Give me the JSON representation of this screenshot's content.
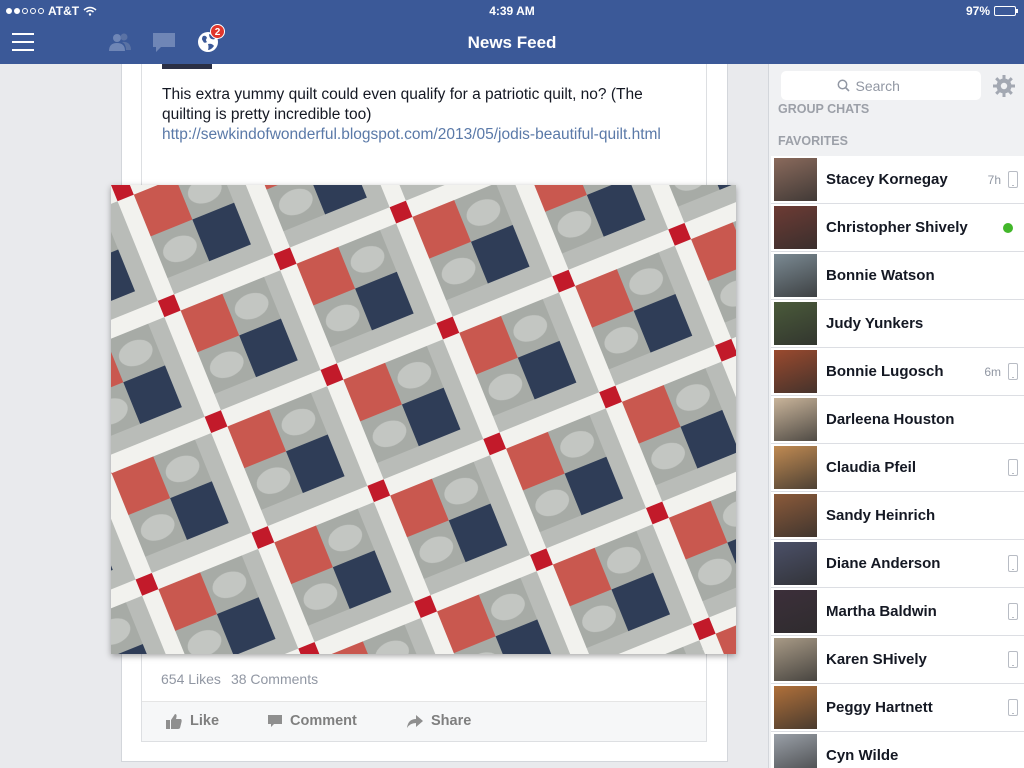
{
  "status_bar": {
    "carrier": "AT&T",
    "time": "4:39 AM",
    "battery": "97%",
    "battery_level": 0.97
  },
  "navbar": {
    "title": "News Feed",
    "notification_count": "2",
    "icons": [
      "menu-icon",
      "friends-icon",
      "messages-icon",
      "globe-icon"
    ]
  },
  "post": {
    "text": "This extra yummy quilt could even qualify for a patriotic quilt, no? (The quilting is pretty incredible too)",
    "link": "http://sewkindofwonderful.blogspot.com/2013/05/jodis-beautiful-quilt.html",
    "likes": "654 Likes",
    "comments": "38 Comments",
    "actions": {
      "like": "Like",
      "comment": "Comment",
      "share": "Share"
    }
  },
  "sidebar": {
    "search_placeholder": "Search",
    "sections": {
      "group_chats": "GROUP CHATS",
      "favorites": "FAVORITES"
    },
    "friends": [
      {
        "name": "Stacey Kornegay",
        "ago": "7h",
        "status": "mobile",
        "avatar_color": "#8a6a5c"
      },
      {
        "name": "Christopher Shively",
        "ago": "",
        "status": "online",
        "avatar_color": "#6d3b34"
      },
      {
        "name": "Bonnie Watson",
        "ago": "",
        "status": "none",
        "avatar_color": "#7b8a93"
      },
      {
        "name": "Judy Yunkers",
        "ago": "",
        "status": "none",
        "avatar_color": "#4a5a3a"
      },
      {
        "name": "Bonnie Lugosch",
        "ago": "6m",
        "status": "mobile",
        "avatar_color": "#9a4a2e"
      },
      {
        "name": "Darleena Houston",
        "ago": "",
        "status": "none",
        "avatar_color": "#c9b49a"
      },
      {
        "name": "Claudia Pfeil",
        "ago": "",
        "status": "mobile",
        "avatar_color": "#c08a52"
      },
      {
        "name": "Sandy Heinrich",
        "ago": "",
        "status": "none",
        "avatar_color": "#8b5a3a"
      },
      {
        "name": "Diane Anderson",
        "ago": "",
        "status": "mobile",
        "avatar_color": "#4b5068"
      },
      {
        "name": "Martha Baldwin",
        "ago": "",
        "status": "mobile",
        "avatar_color": "#3c2f3a"
      },
      {
        "name": "Karen SHively",
        "ago": "",
        "status": "mobile",
        "avatar_color": "#a89a86"
      },
      {
        "name": "Peggy Hartnett",
        "ago": "",
        "status": "mobile",
        "avatar_color": "#b0703a"
      },
      {
        "name": "Cyn Wilde",
        "ago": "",
        "status": "none",
        "avatar_color": "#9aa0a8"
      }
    ]
  }
}
